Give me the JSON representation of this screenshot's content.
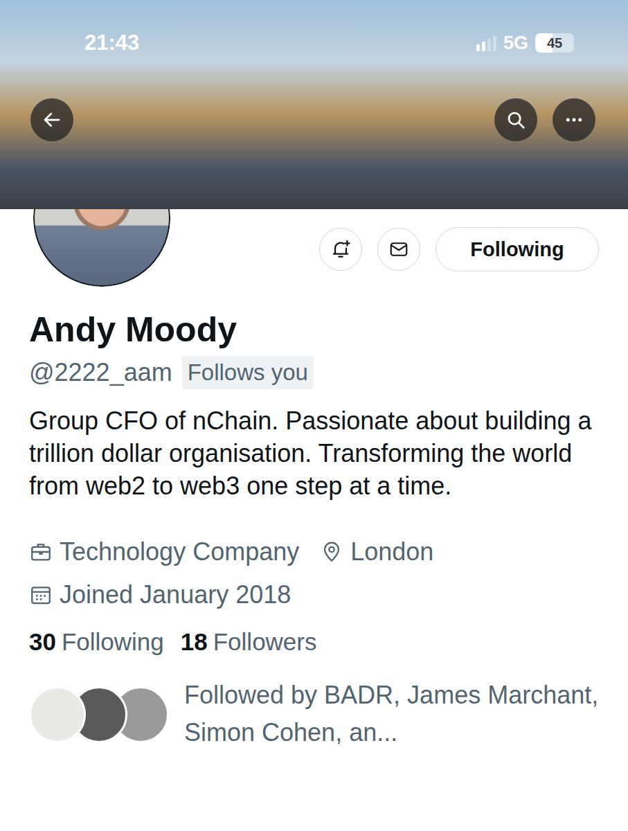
{
  "status_bar": {
    "time": "21:43",
    "network": "5G",
    "battery": "45",
    "battery_level": 0.45,
    "signal_level": 0.5
  },
  "profile": {
    "name": "Andy Moody",
    "handle": "@2222_aam",
    "badge": "Follows you",
    "bio": "Group CFO of nChain. Passionate about building a trillion dollar organisation. Transforming the world from web2 to web3 one step at a time.",
    "meta": [
      {
        "kind": "work",
        "text": "Technology Company"
      },
      {
        "kind": "location",
        "text": "London"
      },
      {
        "kind": "joined",
        "text": "Joined January 2018"
      }
    ]
  },
  "follow_button": {
    "label": "Following",
    "following": true
  },
  "stats": [
    {
      "count": "30",
      "label": "Following"
    },
    {
      "count": "18",
      "label": "Followers"
    }
  ],
  "followed_by": {
    "text": "Followed by BADR, James Marchant, Simon Cohen, an...",
    "avatars": [
      {
        "color": "#e9e9e6"
      },
      {
        "color": "#5a5a5a"
      },
      {
        "color": "#9a9a9a"
      }
    ]
  }
}
